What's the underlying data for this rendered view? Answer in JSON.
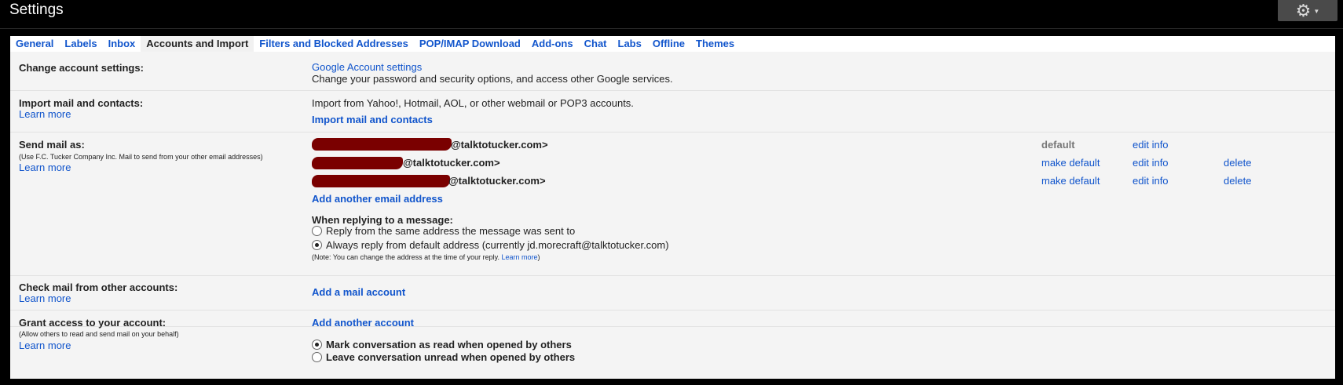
{
  "header": {
    "title": "Settings"
  },
  "tabs": [
    "General",
    "Labels",
    "Inbox",
    "Accounts and Import",
    "Filters and Blocked Addresses",
    "POP/IMAP Download",
    "Add-ons",
    "Chat",
    "Labs",
    "Offline",
    "Themes"
  ],
  "active_tab": "Accounts and Import",
  "change_account": {
    "label": "Change account settings:",
    "link": "Google Account settings",
    "desc": "Change your password and security options, and access other Google services."
  },
  "import_mail": {
    "label": "Import mail and contacts:",
    "learn_more": "Learn more",
    "desc": "Import from Yahoo!, Hotmail, AOL, or other webmail or POP3 accounts.",
    "action": "Import mail and contacts"
  },
  "send_mail": {
    "label": "Send mail as:",
    "sub": "(Use F.C. Tucker Company Inc. Mail to send from your other email addresses)",
    "learn_more": "Learn more",
    "addresses": [
      {
        "text": "@talktotucker.com>",
        "status": "default",
        "make_default": "",
        "edit": "edit info",
        "delete": ""
      },
      {
        "text": "@talktotucker.com>",
        "status": "",
        "make_default": "make default",
        "edit": "edit info",
        "delete": "delete"
      },
      {
        "text": "@talktotucker.com>",
        "status": "",
        "make_default": "make default",
        "edit": "edit info",
        "delete": "delete"
      }
    ],
    "add_another": "Add another email address",
    "reply_heading": "When replying to a message:",
    "reply_option_1": "Reply from the same address the message was sent to",
    "reply_option_2": "Always reply from default address (currently jd.morecraft@talktotucker.com)",
    "reply_selected": 2,
    "note_prefix": "(Note: You can change the address at the time of your reply. ",
    "note_link": "Learn more",
    "note_suffix": ")"
  },
  "check_mail": {
    "label": "Check mail from other accounts:",
    "learn_more": "Learn more",
    "action": "Add a mail account"
  },
  "grant_access": {
    "label": "Grant access to your account:",
    "sub": "(Allow others to read and send mail on your behalf)",
    "learn_more": "Learn more",
    "action": "Add another account",
    "option_1": "Mark conversation as read when opened by others",
    "option_2": "Leave conversation unread when opened by others",
    "selected": 1
  },
  "colors": {
    "link": "#1155cc",
    "panel": "#f4f4f4",
    "redaction": "#7a0000"
  }
}
